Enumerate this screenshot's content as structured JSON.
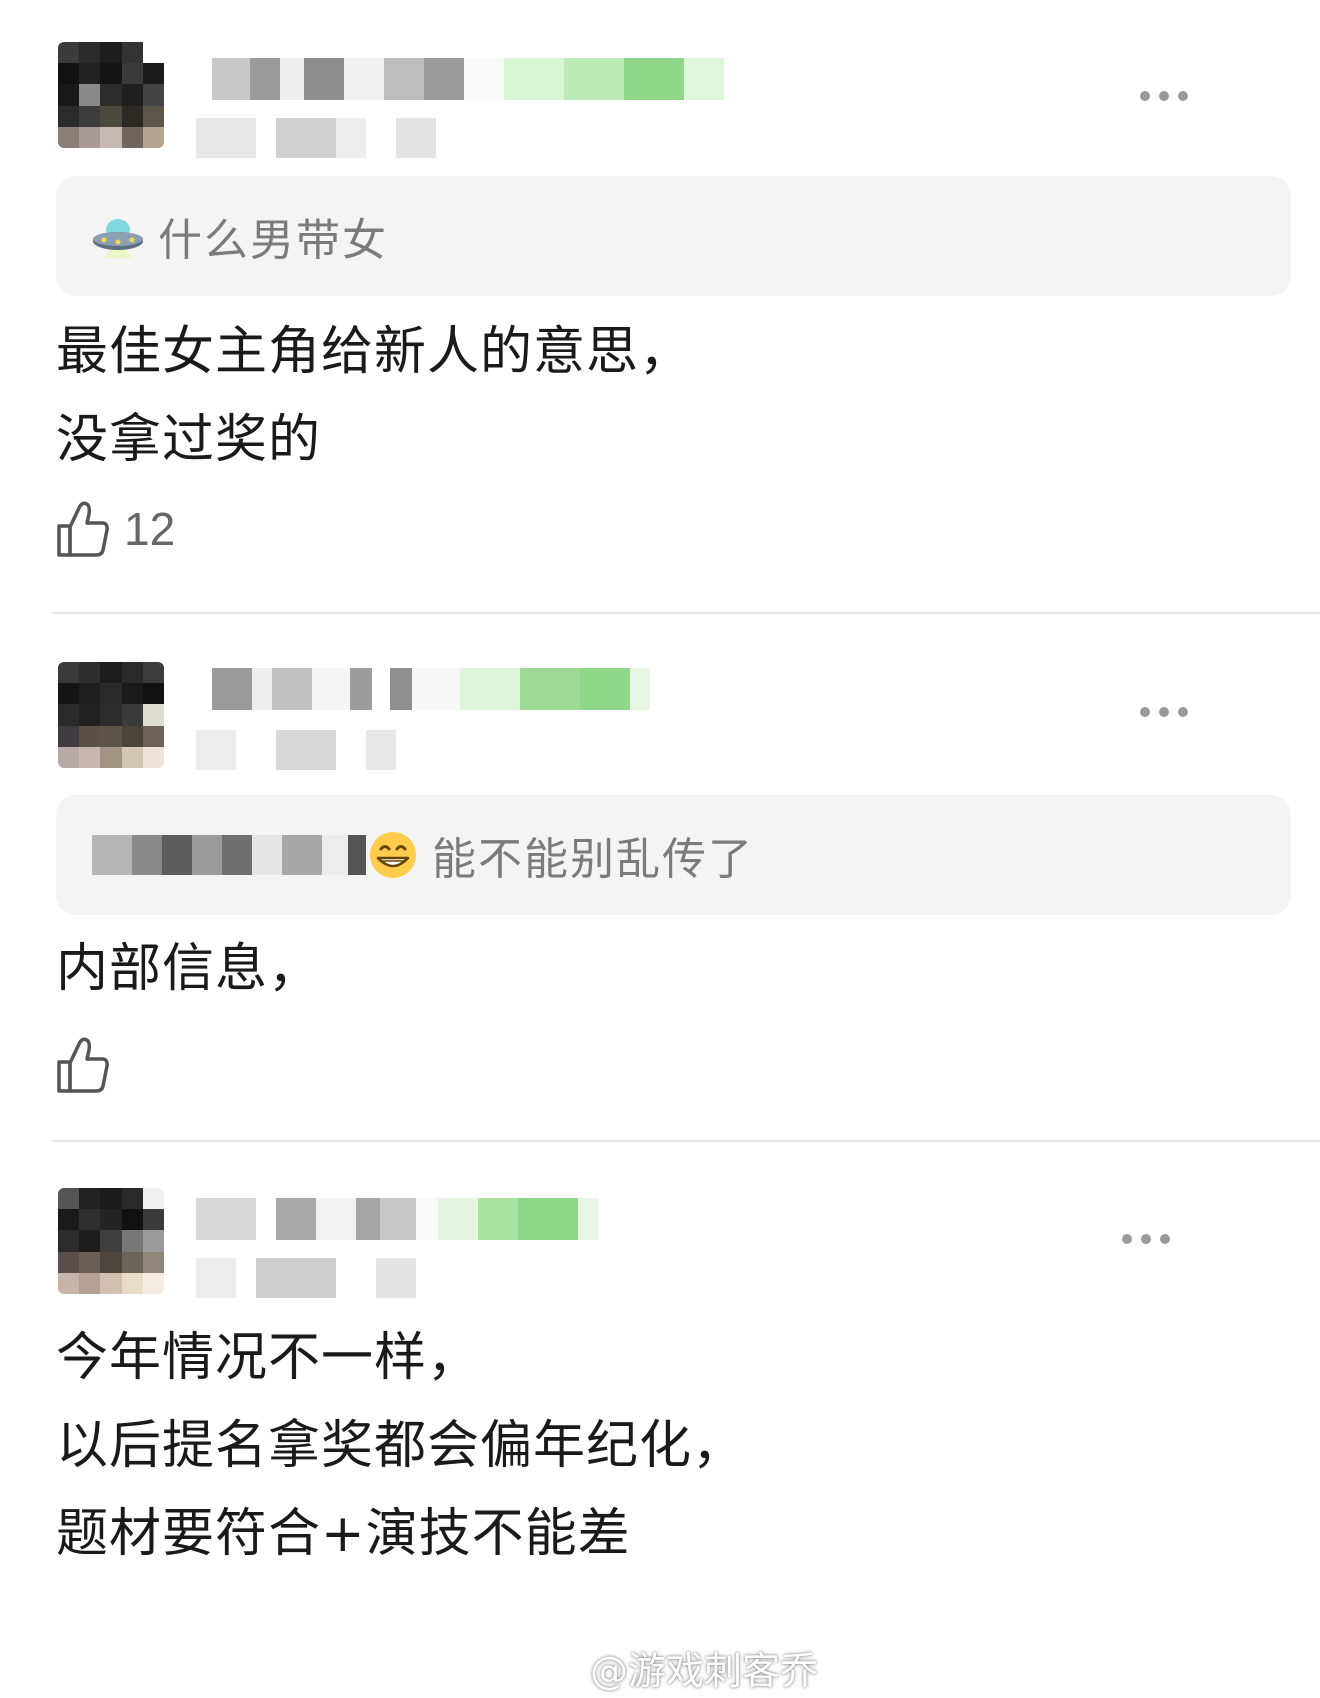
{
  "comments": [
    {
      "quote_text": "什么男带女",
      "quote_icon": "ufo-emoji-icon",
      "body_lines": [
        "最佳女主角给新人的意思，",
        "没拿过奖的"
      ],
      "like_count": "12"
    },
    {
      "quote_text": "能不能别乱传了",
      "quote_icon": "grin-emoji-icon",
      "body_lines": [
        "内部信息，"
      ],
      "like_count": ""
    },
    {
      "quote_text": "",
      "body_lines": [
        "今年情况不一样，",
        "以后提名拿奖都会偏年纪化，",
        "题材要符合+演技不能差"
      ],
      "like_count": ""
    }
  ],
  "watermark": "@游戏刺客乔",
  "colors": {
    "quote_bg": "#f4f4f4",
    "blur_green": "#8fd88a",
    "text": "#1a1a1a",
    "muted": "#7b7b7b"
  }
}
